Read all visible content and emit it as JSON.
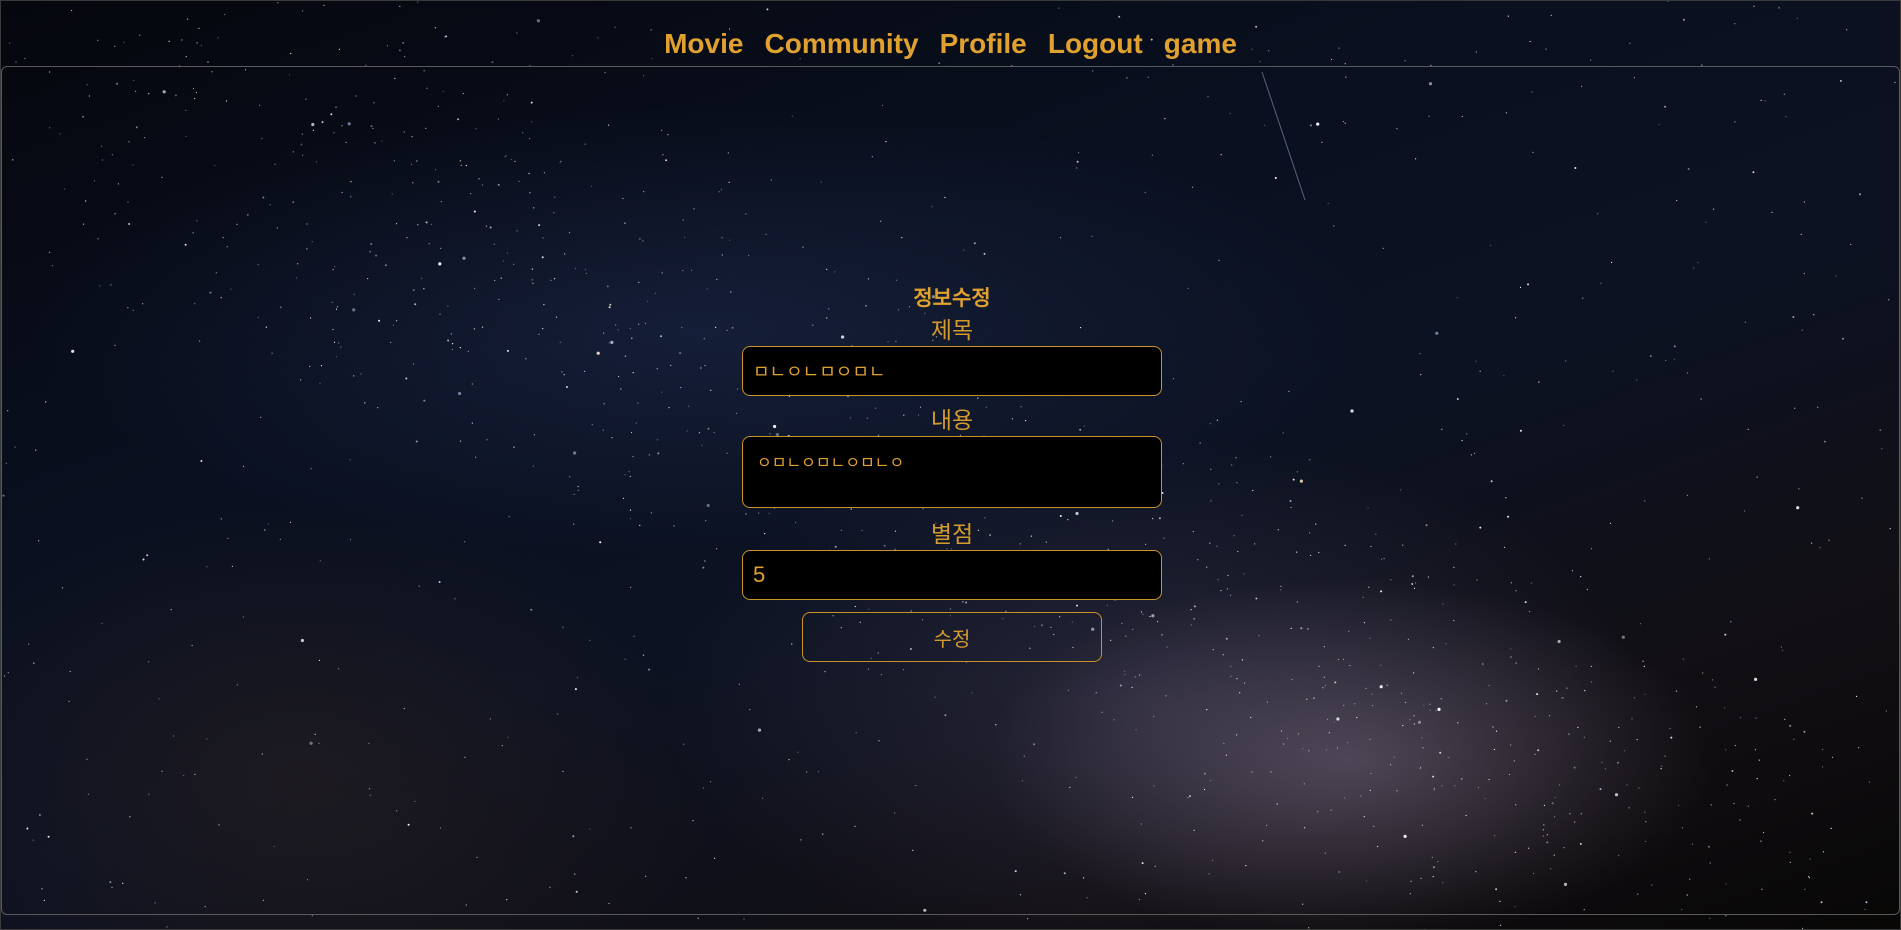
{
  "nav": {
    "items": [
      {
        "label": "Movie"
      },
      {
        "label": "Community"
      },
      {
        "label": "Profile"
      },
      {
        "label": "Logout"
      },
      {
        "label": "game"
      }
    ]
  },
  "form": {
    "title": "정보수정",
    "title_label": "제목",
    "title_value": "ㅁㄴㅇㄴㅁㅇㅁㄴ",
    "content_label": "내용",
    "content_value": "ㅇㅁㄴㅇㅁㄴㅇㅁㄴㅇ",
    "rating_label": "별점",
    "rating_value": "5",
    "submit_label": "수정"
  },
  "colors": {
    "accent": "#e0a12f",
    "input_border": "#c8922a",
    "background": "#000000"
  }
}
